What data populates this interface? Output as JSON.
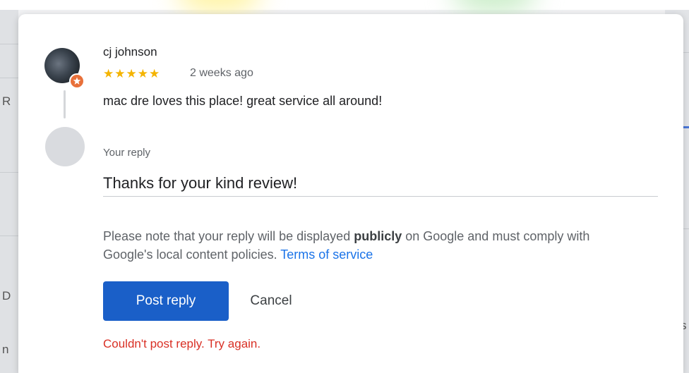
{
  "background": {
    "left_fragments": [
      "R",
      "D",
      "n"
    ],
    "right_fragments": [
      "s"
    ]
  },
  "review": {
    "reviewer_name": "cj johnson",
    "rating": 5,
    "stars": "★★★★★",
    "time": "2 weeks ago",
    "text": "mac dre loves this place! great service all around!"
  },
  "reply": {
    "label": "Your reply",
    "value": "Thanks for your kind review!"
  },
  "notice": {
    "prefix": "Please note that your reply will be displayed ",
    "emphasis": "publicly",
    "suffix": " on Google and must comply with Google's local content policies. ",
    "link": "Terms of service"
  },
  "actions": {
    "post_label": "Post reply",
    "cancel_label": "Cancel"
  },
  "error": "Couldn't post reply. Try again.",
  "colors": {
    "primary": "#1a5fc8",
    "link": "#1a73e8",
    "error": "#d93025",
    "star": "#f4b400"
  }
}
